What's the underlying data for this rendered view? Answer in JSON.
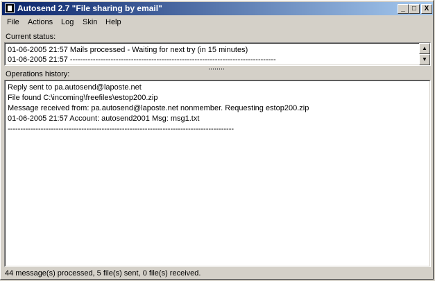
{
  "window": {
    "title": "Autosend 2.7 \"File sharing by email\"",
    "controls": {
      "minimize": "_",
      "maximize": "□",
      "close": "X"
    }
  },
  "menu": {
    "items": [
      {
        "label": "File"
      },
      {
        "label": "Actions"
      },
      {
        "label": "Log"
      },
      {
        "label": "Skin"
      },
      {
        "label": "Help"
      }
    ]
  },
  "current_status": {
    "label": "Current status:",
    "lines": [
      "01-06-2005 21:57 Mails processed - Waiting for next try (in 15 minutes)",
      "01-06-2005 21:57 ---------------------------------------------------------------------------------"
    ]
  },
  "history": {
    "label": "Operations history:",
    "lines": [
      "Reply sent to pa.autosend@laposte.net",
      "File found C:\\incoming\\freefiles\\estop200.zip",
      "Message received from: pa.autosend@laposte.net nonmember. Requesting estop200.zip",
      "01-06-2005 21:57 Account: autosend2001 Msg: msg1.txt",
      "-----------------------------------------------------------------------------------------"
    ]
  },
  "statusbar": {
    "text": "44 message(s) processed, 5 file(s) sent,  0 file(s) received."
  }
}
